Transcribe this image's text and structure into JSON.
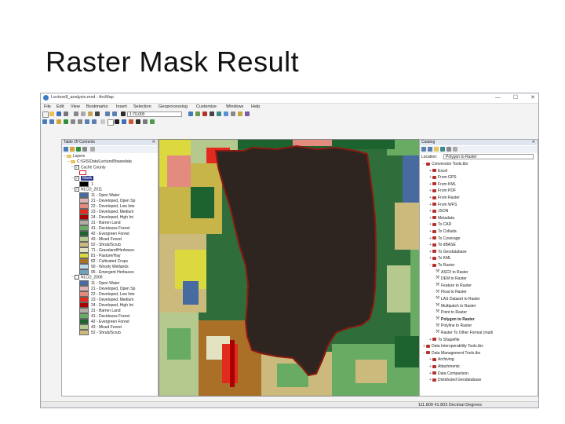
{
  "slide": {
    "title": "Raster Mask Result"
  },
  "window": {
    "title": "Lecture8_analysis.mxd - ArcMap",
    "controls": [
      "—",
      "☐",
      "✕"
    ]
  },
  "menu": [
    "File",
    "Edit",
    "View",
    "Bookmarks",
    "Insert",
    "Selection",
    "Geoprocessing",
    "Customize",
    "Windows",
    "Help"
  ],
  "toolbar": {
    "scale": "1:70,000"
  },
  "toc": {
    "header": "Table Of Contents",
    "root": "Layers",
    "folder": "C:\\GIS\\Data\\Lecture8\\basedata",
    "layers": [
      {
        "label": "Cache County",
        "checked": true
      },
      {
        "label": "1",
        "checked": true,
        "color": "#d21f1f"
      },
      {
        "label": "Mask",
        "checked": true,
        "color": "#2b3a8c"
      },
      {
        "label": "1",
        "color": "#000000"
      }
    ],
    "nlcd2011": {
      "name": "NLCD_2011",
      "classes": [
        {
          "label": "11 - Open Water",
          "color": "#476ba1"
        },
        {
          "label": "21 - Developed, Open Sp",
          "color": "#dcb2b2"
        },
        {
          "label": "22 - Developed, Low Inte",
          "color": "#e38b7f"
        },
        {
          "label": "23 - Developed, Medium",
          "color": "#e32a1f"
        },
        {
          "label": "24 - Developed, High Int",
          "color": "#ab0000"
        },
        {
          "label": "31 - Barren Land",
          "color": "#b3aca3"
        },
        {
          "label": "41 - Deciduous Forest",
          "color": "#68ab63"
        },
        {
          "label": "42 - Evergreen Forest",
          "color": "#1c6330"
        },
        {
          "label": "43 - Mixed Forest",
          "color": "#b5c98f"
        },
        {
          "label": "52 - Shrub/Scrub",
          "color": "#ccba7d"
        },
        {
          "label": "71 - Grassland/Herbacec",
          "color": "#e3e3c2"
        },
        {
          "label": "81 - Pasture/Hay",
          "color": "#dbd93d"
        },
        {
          "label": "82 - Cultivated Crops",
          "color": "#ab7028"
        },
        {
          "label": "90 - Woody Wetlands",
          "color": "#bad9eb"
        },
        {
          "label": "95 - Emergent Herbaceo",
          "color": "#70a3ba"
        }
      ]
    },
    "nlcd2006": {
      "name": "NLCD_2006",
      "classes": [
        {
          "label": "11 - Open Water",
          "color": "#476ba1"
        },
        {
          "label": "21 - Developed, Open Sp",
          "color": "#dcb2b2"
        },
        {
          "label": "22 - Developed, Low Inte",
          "color": "#e38b7f"
        },
        {
          "label": "23 - Developed, Medium",
          "color": "#e32a1f"
        },
        {
          "label": "24 - Developed, High Int",
          "color": "#ab0000"
        },
        {
          "label": "31 - Barren Land",
          "color": "#b3aca3"
        },
        {
          "label": "41 - Deciduous Forest",
          "color": "#68ab63"
        },
        {
          "label": "42 - Evergreen Forest",
          "color": "#1c6330"
        },
        {
          "label": "43 - Mixed Forest",
          "color": "#b5c98f"
        },
        {
          "label": "52 - Shrub/Scrub",
          "color": "#ccba7d"
        }
      ]
    }
  },
  "catalog": {
    "header": "Catalog",
    "location_label": "Location:",
    "location_value": "Polygon to Raster",
    "items": [
      {
        "label": "Conversion Tools.tbx",
        "type": "toolbox",
        "expanded": true
      },
      {
        "label": "Excel",
        "type": "toolset"
      },
      {
        "label": "From GPS",
        "type": "toolset"
      },
      {
        "label": "From KML",
        "type": "toolset"
      },
      {
        "label": "From PDF",
        "type": "toolset"
      },
      {
        "label": "From Raster",
        "type": "toolset"
      },
      {
        "label": "From WFS",
        "type": "toolset"
      },
      {
        "label": "JSON",
        "type": "toolset"
      },
      {
        "label": "Metadata",
        "type": "toolset"
      },
      {
        "label": "To CAD",
        "type": "toolset"
      },
      {
        "label": "To Collada",
        "type": "toolset"
      },
      {
        "label": "To Coverage",
        "type": "toolset"
      },
      {
        "label": "To dBASE",
        "type": "toolset"
      },
      {
        "label": "To Geodatabase",
        "type": "toolset"
      },
      {
        "label": "To KML",
        "type": "toolset"
      },
      {
        "label": "To Raster",
        "type": "toolset",
        "expanded": true
      },
      {
        "label": "ASCII to Raster",
        "type": "tool"
      },
      {
        "label": "DEM to Raster",
        "type": "tool"
      },
      {
        "label": "Feature to Raster",
        "type": "tool"
      },
      {
        "label": "Float to Raster",
        "type": "tool"
      },
      {
        "label": "LAS Dataset to Raster",
        "type": "tool"
      },
      {
        "label": "Multipatch to Raster",
        "type": "tool"
      },
      {
        "label": "Point to Raster",
        "type": "tool"
      },
      {
        "label": "Polygon to Raster",
        "type": "tool",
        "selected": true
      },
      {
        "label": "Polyline to Raster",
        "type": "tool"
      },
      {
        "label": "Raster To Other Format (multi",
        "type": "tool"
      },
      {
        "label": "To Shapefile",
        "type": "toolset"
      },
      {
        "label": "Data Interoperability Tools.tbx",
        "type": "toolbox"
      },
      {
        "label": "Data Management Tools.tbx",
        "type": "toolbox",
        "expanded": true
      },
      {
        "label": "Archiving",
        "type": "toolset"
      },
      {
        "label": "Attachments",
        "type": "toolset"
      },
      {
        "label": "Data Comparison",
        "type": "toolset"
      },
      {
        "label": "Distributed Geodatabase",
        "type": "toolset"
      }
    ]
  },
  "status": {
    "coords": "111.809  41.803 Decimal Degrees"
  },
  "map": {
    "mask_color": "#2e2521",
    "mask_outline": "#8b1a12"
  }
}
